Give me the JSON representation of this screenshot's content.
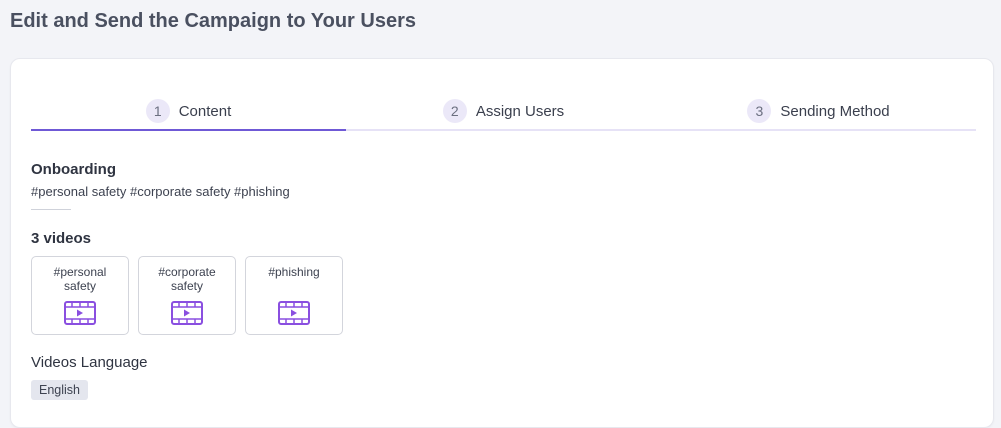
{
  "page": {
    "title": "Edit and Send the Campaign to Your Users"
  },
  "steps": [
    {
      "num": "1",
      "label": "Content"
    },
    {
      "num": "2",
      "label": "Assign Users"
    },
    {
      "num": "3",
      "label": "Sending Method"
    }
  ],
  "active_step": 1,
  "campaign": {
    "name": "Onboarding",
    "tags": "#personal safety #corporate safety #phishing"
  },
  "videos": {
    "count_label": "3 videos",
    "items": [
      {
        "tag": "#personal safety",
        "icon": "video-icon"
      },
      {
        "tag": "#corporate safety",
        "icon": "video-icon"
      },
      {
        "tag": "#phishing",
        "icon": "video-icon"
      }
    ]
  },
  "language": {
    "title": "Videos Language",
    "value": "English"
  },
  "colors": {
    "accent": "#6f59d6",
    "icon": "#8a4fe0"
  }
}
